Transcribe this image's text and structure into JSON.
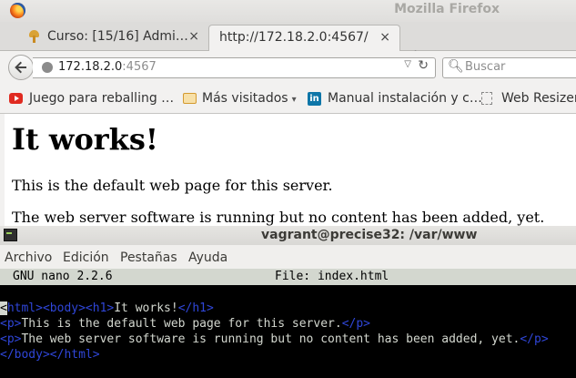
{
  "browser": {
    "window_title": "Mozilla Firefox",
    "tabs": [
      {
        "label": "Curso: [15/16] Admi…",
        "close": "×",
        "active": false
      },
      {
        "label": "http://172.18.2.0:4567/",
        "close": "×",
        "active": true
      }
    ],
    "new_tab": "+",
    "url": {
      "host": "172.18.2.0",
      "port": ":4567"
    },
    "search_placeholder": "Buscar",
    "bookmarks": [
      {
        "label": "Juego para reballing …",
        "icon": "youtube-icon"
      },
      {
        "label": "Más visitados",
        "icon": "folder-icon",
        "dropdown": "▾"
      },
      {
        "label": "Manual instalación y c…",
        "icon": "linkedin-icon"
      },
      {
        "label": "Web Resizer",
        "icon": "page-icon"
      }
    ],
    "page": {
      "heading": "It works!",
      "paragraphs": [
        "This is the default web page for this server.",
        "The web server software is running but no content has been added, yet."
      ]
    }
  },
  "terminal": {
    "title": "vagrant@precise32: /var/www",
    "menu": [
      "Archivo",
      "Edición",
      "Pestañas",
      "Ayuda"
    ],
    "nano": {
      "version": "GNU nano 2.2.6",
      "file": "File: index.html",
      "lines": [
        {
          "cursor": "<",
          "open": "html><body><h1>",
          "text": "It works!",
          "close": "</h1>"
        },
        {
          "open": "<p>",
          "text": "This is the default web page for this server.",
          "close": "</p>"
        },
        {
          "open": "<p>",
          "text": "The web server software is running but no content has been added, yet.",
          "close": "</p>"
        },
        {
          "open": "</body></html>",
          "text": "",
          "close": ""
        }
      ]
    }
  },
  "colors": {
    "nano_tag": "#2f46d8",
    "nano_text": "#d3d7cf",
    "nano_bg": "#000000"
  }
}
